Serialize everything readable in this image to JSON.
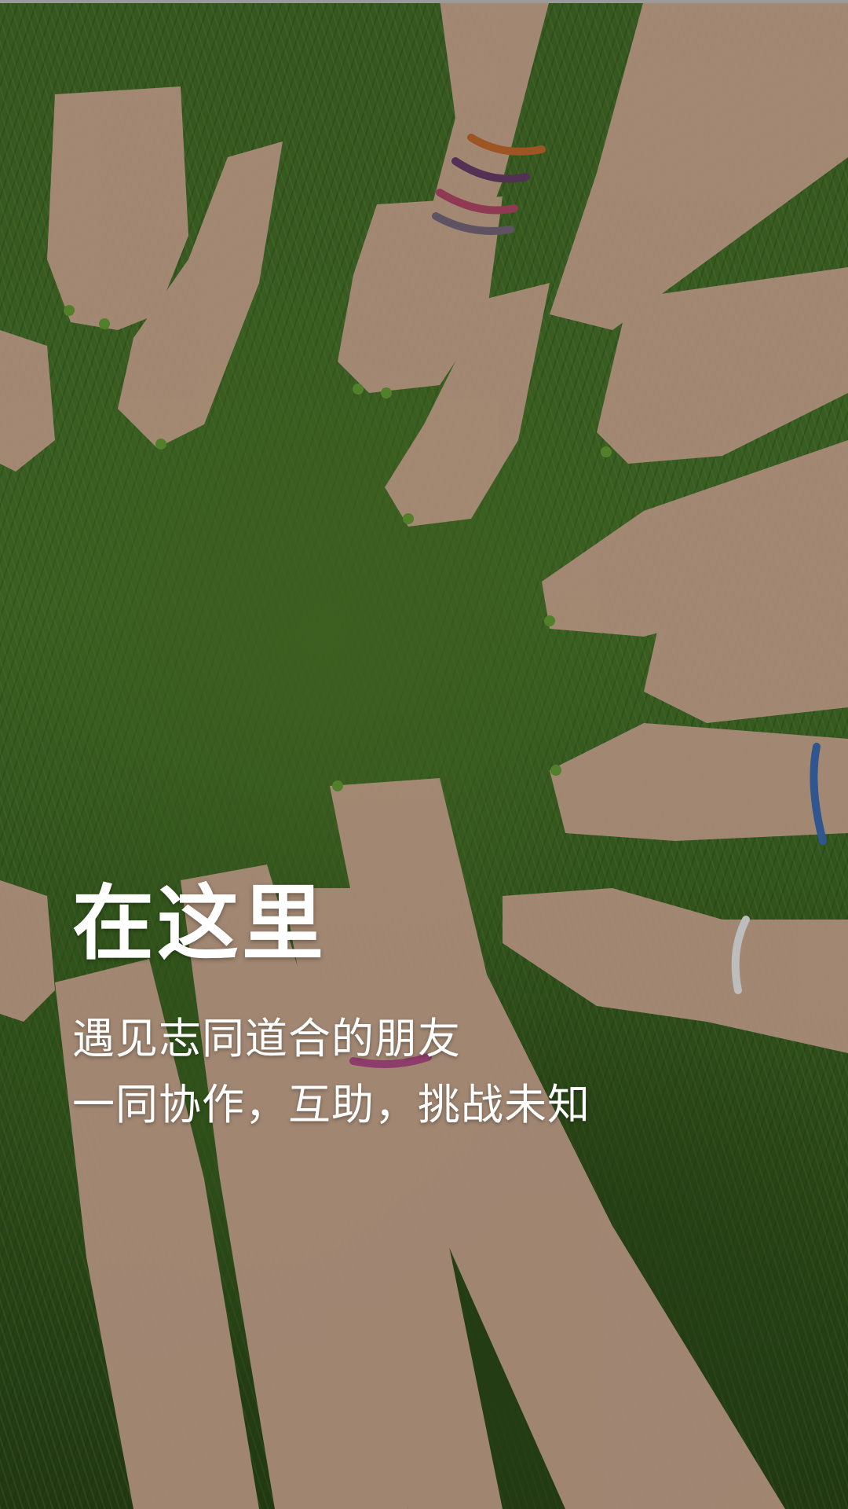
{
  "hero": {
    "headline": "在这里",
    "lines": [
      "遇见志同道合的朋友",
      "一同协作，互助，挑战未知"
    ]
  },
  "colors": {
    "text": "#ffffff",
    "grass": "#4a7a2c",
    "skin": "#e8c2a8"
  }
}
